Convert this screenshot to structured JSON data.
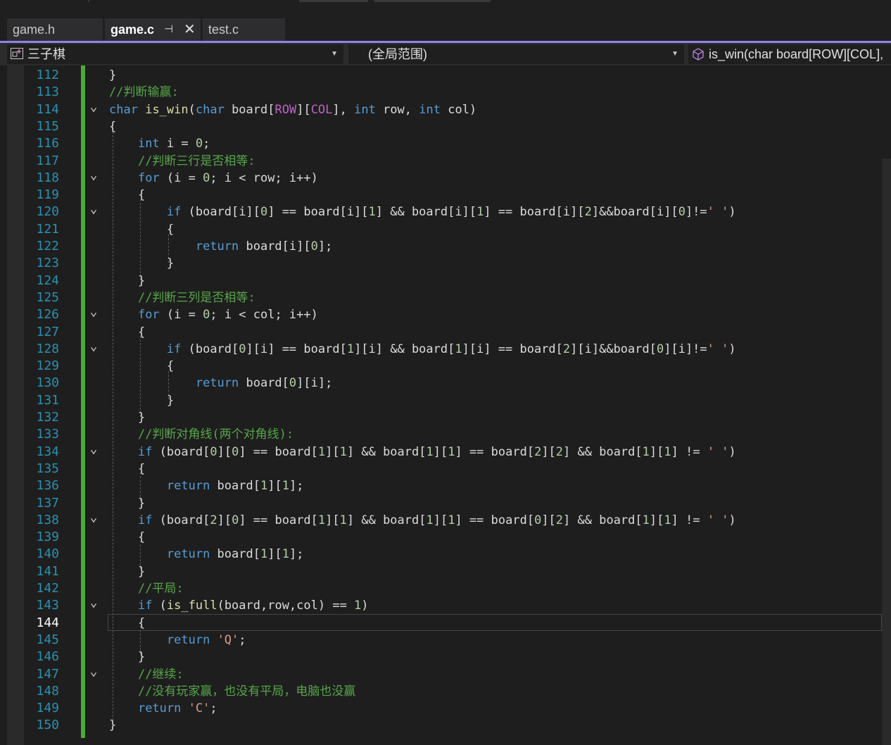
{
  "tabs": [
    {
      "label": "game.h",
      "active": false
    },
    {
      "label": "game.c",
      "active": true
    },
    {
      "label": "test.c",
      "active": false
    }
  ],
  "nav": {
    "project": "三子棋",
    "scope": "(全局范围)",
    "member": "is_win(char board[ROW][COL],"
  },
  "colors": {
    "keyword": "#569cd6",
    "function": "#dcdcaa",
    "comment": "#57a64a",
    "string": "#d69d85",
    "number": "#b5cea8",
    "macro": "#bd63c5",
    "line_number": "#2b91af",
    "change_bar": "#4caa3a",
    "tab_accent": "#8f83e8"
  },
  "editor": {
    "current_line": 144,
    "lines": [
      {
        "n": 112,
        "fold": false,
        "tokens": [
          [
            "t",
            "}"
          ]
        ]
      },
      {
        "n": 113,
        "fold": false,
        "tokens": [
          [
            "c",
            "//判断输赢:"
          ]
        ]
      },
      {
        "n": 114,
        "fold": true,
        "tokens": [
          [
            "k",
            "char"
          ],
          [
            "t",
            " "
          ],
          [
            "f",
            "is_win"
          ],
          [
            "t",
            "("
          ],
          [
            "k",
            "char"
          ],
          [
            "t",
            " board["
          ],
          [
            "m",
            "ROW"
          ],
          [
            "t",
            "]["
          ],
          [
            "m",
            "COL"
          ],
          [
            "t",
            "], "
          ],
          [
            "k",
            "int"
          ],
          [
            "t",
            " row, "
          ],
          [
            "k",
            "int"
          ],
          [
            "t",
            " col)"
          ]
        ]
      },
      {
        "n": 115,
        "fold": false,
        "tokens": [
          [
            "t",
            "{"
          ]
        ]
      },
      {
        "n": 116,
        "fold": false,
        "tokens": [
          [
            "t",
            "    "
          ],
          [
            "k",
            "int"
          ],
          [
            "t",
            " i = "
          ],
          [
            "d",
            "0"
          ],
          [
            "t",
            ";"
          ]
        ]
      },
      {
        "n": 117,
        "fold": false,
        "tokens": [
          [
            "t",
            "    "
          ],
          [
            "c",
            "//判断三行是否相等:"
          ]
        ]
      },
      {
        "n": 118,
        "fold": true,
        "tokens": [
          [
            "t",
            "    "
          ],
          [
            "k",
            "for"
          ],
          [
            "t",
            " (i = "
          ],
          [
            "d",
            "0"
          ],
          [
            "t",
            "; i < row; i++)"
          ]
        ]
      },
      {
        "n": 119,
        "fold": false,
        "tokens": [
          [
            "t",
            "    {"
          ]
        ]
      },
      {
        "n": 120,
        "fold": true,
        "tokens": [
          [
            "t",
            "        "
          ],
          [
            "k",
            "if"
          ],
          [
            "t",
            " (board[i]["
          ],
          [
            "d",
            "0"
          ],
          [
            "t",
            "] == board[i]["
          ],
          [
            "d",
            "1"
          ],
          [
            "t",
            "] && board[i]["
          ],
          [
            "d",
            "1"
          ],
          [
            "t",
            "] == board[i]["
          ],
          [
            "d",
            "2"
          ],
          [
            "t",
            "]&&board[i]["
          ],
          [
            "d",
            "0"
          ],
          [
            "t",
            "]!="
          ],
          [
            "s",
            "' '"
          ],
          [
            "t",
            ")"
          ]
        ]
      },
      {
        "n": 121,
        "fold": false,
        "tokens": [
          [
            "t",
            "        {"
          ]
        ]
      },
      {
        "n": 122,
        "fold": false,
        "tokens": [
          [
            "t",
            "            "
          ],
          [
            "k",
            "return"
          ],
          [
            "t",
            " board[i]["
          ],
          [
            "d",
            "0"
          ],
          [
            "t",
            "];"
          ]
        ]
      },
      {
        "n": 123,
        "fold": false,
        "tokens": [
          [
            "t",
            "        }"
          ]
        ]
      },
      {
        "n": 124,
        "fold": false,
        "tokens": [
          [
            "t",
            "    }"
          ]
        ]
      },
      {
        "n": 125,
        "fold": false,
        "tokens": [
          [
            "t",
            "    "
          ],
          [
            "c",
            "//判断三列是否相等:"
          ]
        ]
      },
      {
        "n": 126,
        "fold": true,
        "tokens": [
          [
            "t",
            "    "
          ],
          [
            "k",
            "for"
          ],
          [
            "t",
            " (i = "
          ],
          [
            "d",
            "0"
          ],
          [
            "t",
            "; i < col; i++)"
          ]
        ]
      },
      {
        "n": 127,
        "fold": false,
        "tokens": [
          [
            "t",
            "    {"
          ]
        ]
      },
      {
        "n": 128,
        "fold": true,
        "tokens": [
          [
            "t",
            "        "
          ],
          [
            "k",
            "if"
          ],
          [
            "t",
            " (board["
          ],
          [
            "d",
            "0"
          ],
          [
            "t",
            "][i] == board["
          ],
          [
            "d",
            "1"
          ],
          [
            "t",
            "][i] && board["
          ],
          [
            "d",
            "1"
          ],
          [
            "t",
            "][i] == board["
          ],
          [
            "d",
            "2"
          ],
          [
            "t",
            "][i]&&board["
          ],
          [
            "d",
            "0"
          ],
          [
            "t",
            "][i]!="
          ],
          [
            "s",
            "' '"
          ],
          [
            "t",
            ")"
          ]
        ]
      },
      {
        "n": 129,
        "fold": false,
        "tokens": [
          [
            "t",
            "        {"
          ]
        ]
      },
      {
        "n": 130,
        "fold": false,
        "tokens": [
          [
            "t",
            "            "
          ],
          [
            "k",
            "return"
          ],
          [
            "t",
            " board["
          ],
          [
            "d",
            "0"
          ],
          [
            "t",
            "][i];"
          ]
        ]
      },
      {
        "n": 131,
        "fold": false,
        "tokens": [
          [
            "t",
            "        }"
          ]
        ]
      },
      {
        "n": 132,
        "fold": false,
        "tokens": [
          [
            "t",
            "    }"
          ]
        ]
      },
      {
        "n": 133,
        "fold": false,
        "tokens": [
          [
            "t",
            "    "
          ],
          [
            "c",
            "//判断对角线(两个对角线):"
          ]
        ]
      },
      {
        "n": 134,
        "fold": true,
        "tokens": [
          [
            "t",
            "    "
          ],
          [
            "k",
            "if"
          ],
          [
            "t",
            " (board["
          ],
          [
            "d",
            "0"
          ],
          [
            "t",
            "]["
          ],
          [
            "d",
            "0"
          ],
          [
            "t",
            "] == board["
          ],
          [
            "d",
            "1"
          ],
          [
            "t",
            "]["
          ],
          [
            "d",
            "1"
          ],
          [
            "t",
            "] && board["
          ],
          [
            "d",
            "1"
          ],
          [
            "t",
            "]["
          ],
          [
            "d",
            "1"
          ],
          [
            "t",
            "] == board["
          ],
          [
            "d",
            "2"
          ],
          [
            "t",
            "]["
          ],
          [
            "d",
            "2"
          ],
          [
            "t",
            "] && board["
          ],
          [
            "d",
            "1"
          ],
          [
            "t",
            "]["
          ],
          [
            "d",
            "1"
          ],
          [
            "t",
            "] != "
          ],
          [
            "s",
            "' '"
          ],
          [
            "t",
            ")"
          ]
        ]
      },
      {
        "n": 135,
        "fold": false,
        "tokens": [
          [
            "t",
            "    {"
          ]
        ]
      },
      {
        "n": 136,
        "fold": false,
        "tokens": [
          [
            "t",
            "        "
          ],
          [
            "k",
            "return"
          ],
          [
            "t",
            " board["
          ],
          [
            "d",
            "1"
          ],
          [
            "t",
            "]["
          ],
          [
            "d",
            "1"
          ],
          [
            "t",
            "];"
          ]
        ]
      },
      {
        "n": 137,
        "fold": false,
        "tokens": [
          [
            "t",
            "    }"
          ]
        ]
      },
      {
        "n": 138,
        "fold": true,
        "tokens": [
          [
            "t",
            "    "
          ],
          [
            "k",
            "if"
          ],
          [
            "t",
            " (board["
          ],
          [
            "d",
            "2"
          ],
          [
            "t",
            "]["
          ],
          [
            "d",
            "0"
          ],
          [
            "t",
            "] == board["
          ],
          [
            "d",
            "1"
          ],
          [
            "t",
            "]["
          ],
          [
            "d",
            "1"
          ],
          [
            "t",
            "] && board["
          ],
          [
            "d",
            "1"
          ],
          [
            "t",
            "]["
          ],
          [
            "d",
            "1"
          ],
          [
            "t",
            "] == board["
          ],
          [
            "d",
            "0"
          ],
          [
            "t",
            "]["
          ],
          [
            "d",
            "2"
          ],
          [
            "t",
            "] && board["
          ],
          [
            "d",
            "1"
          ],
          [
            "t",
            "]["
          ],
          [
            "d",
            "1"
          ],
          [
            "t",
            "] != "
          ],
          [
            "s",
            "' '"
          ],
          [
            "t",
            ")"
          ]
        ]
      },
      {
        "n": 139,
        "fold": false,
        "tokens": [
          [
            "t",
            "    {"
          ]
        ]
      },
      {
        "n": 140,
        "fold": false,
        "tokens": [
          [
            "t",
            "        "
          ],
          [
            "k",
            "return"
          ],
          [
            "t",
            " board["
          ],
          [
            "d",
            "1"
          ],
          [
            "t",
            "]["
          ],
          [
            "d",
            "1"
          ],
          [
            "t",
            "];"
          ]
        ]
      },
      {
        "n": 141,
        "fold": false,
        "tokens": [
          [
            "t",
            "    }"
          ]
        ]
      },
      {
        "n": 142,
        "fold": false,
        "tokens": [
          [
            "t",
            "    "
          ],
          [
            "c",
            "//平局:"
          ]
        ]
      },
      {
        "n": 143,
        "fold": true,
        "tokens": [
          [
            "t",
            "    "
          ],
          [
            "k",
            "if"
          ],
          [
            "t",
            " ("
          ],
          [
            "f",
            "is_full"
          ],
          [
            "t",
            "(board,row,col) == "
          ],
          [
            "d",
            "1"
          ],
          [
            "t",
            ")"
          ]
        ]
      },
      {
        "n": 144,
        "fold": false,
        "tokens": [
          [
            "t",
            "    {"
          ]
        ]
      },
      {
        "n": 145,
        "fold": false,
        "tokens": [
          [
            "t",
            "        "
          ],
          [
            "k",
            "return"
          ],
          [
            "t",
            " "
          ],
          [
            "s",
            "'Q'"
          ],
          [
            "t",
            ";"
          ]
        ]
      },
      {
        "n": 146,
        "fold": false,
        "tokens": [
          [
            "t",
            "    }"
          ]
        ]
      },
      {
        "n": 147,
        "fold": true,
        "tokens": [
          [
            "t",
            "    "
          ],
          [
            "c",
            "//继续:"
          ]
        ]
      },
      {
        "n": 148,
        "fold": false,
        "tokens": [
          [
            "t",
            "    "
          ],
          [
            "c",
            "//没有玩家赢，也没有平局，电脑也没赢"
          ]
        ]
      },
      {
        "n": 149,
        "fold": false,
        "tokens": [
          [
            "t",
            "    "
          ],
          [
            "k",
            "return"
          ],
          [
            "t",
            " "
          ],
          [
            "s",
            "'C'"
          ],
          [
            "t",
            ";"
          ]
        ]
      },
      {
        "n": 150,
        "fold": false,
        "tokens": [
          [
            "t",
            "}"
          ]
        ]
      }
    ]
  }
}
